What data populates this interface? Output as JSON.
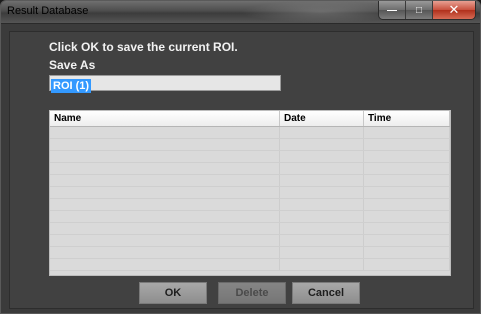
{
  "window": {
    "title": "Result Database",
    "controls": {
      "minimize": "—",
      "maximize": "□",
      "close": "✕"
    }
  },
  "dialog": {
    "instruction": "Click OK to save the current ROI.",
    "save_as_label": "Save As",
    "save_as_value": "ROI (1)"
  },
  "table": {
    "columns": [
      "Name",
      "Date",
      "Time"
    ],
    "rows": []
  },
  "buttons": {
    "ok": "OK",
    "delete": "Delete",
    "cancel": "Cancel"
  }
}
